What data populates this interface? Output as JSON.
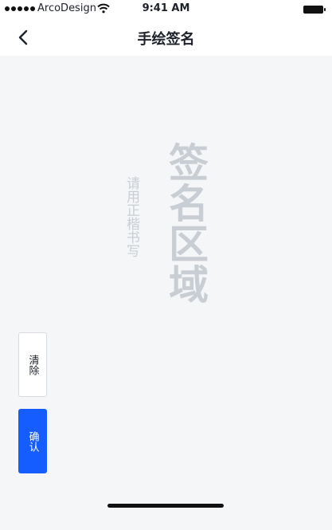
{
  "status_bar": {
    "carrier": "ArcoDesign",
    "time": "9:41 AM",
    "icons": [
      "signal-dots-icon",
      "wifi-icon",
      "battery-icon"
    ]
  },
  "nav": {
    "back_icon": "chevron-left-icon",
    "title": "手绘签名"
  },
  "signature_area": {
    "placeholder_title": "签名区域",
    "placeholder_hint": "请用正楷书写"
  },
  "buttons": {
    "clear_label": "清除",
    "confirm_label": "确认"
  },
  "colors": {
    "accent": "#165dff",
    "background": "#f5f6f8",
    "placeholder": "#c9cdd4"
  }
}
